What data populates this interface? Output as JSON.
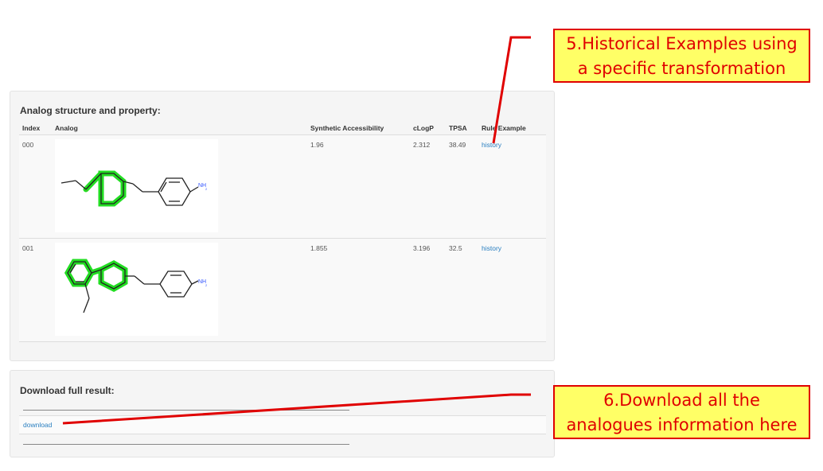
{
  "analog_panel": {
    "title": "Analog structure and property:",
    "columns": [
      "Index",
      "Analog",
      "Synthetic Accessibility",
      "cLogP",
      "TPSA",
      "Rule Example"
    ],
    "rows": [
      {
        "index": "000",
        "sa": "1.96",
        "clogp": "2.312",
        "tpsa": "38.49",
        "rule": "history"
      },
      {
        "index": "001",
        "sa": "1.855",
        "clogp": "3.196",
        "tpsa": "32.5",
        "rule": "history"
      }
    ],
    "amine_label": "NH",
    "amine_sub": "2"
  },
  "download_panel": {
    "title": "Download full result:",
    "link": "download"
  },
  "callouts": {
    "history": {
      "line1": "5.Historical Examples using",
      "line2": "a specific transformation"
    },
    "download": {
      "line1": "6.Download all the",
      "line2": "analogues information here"
    }
  },
  "colors": {
    "highlight": "#22dd22",
    "annotation": "#e00000",
    "link": "#2a7fc0",
    "callout_bg": "#ffff66"
  }
}
